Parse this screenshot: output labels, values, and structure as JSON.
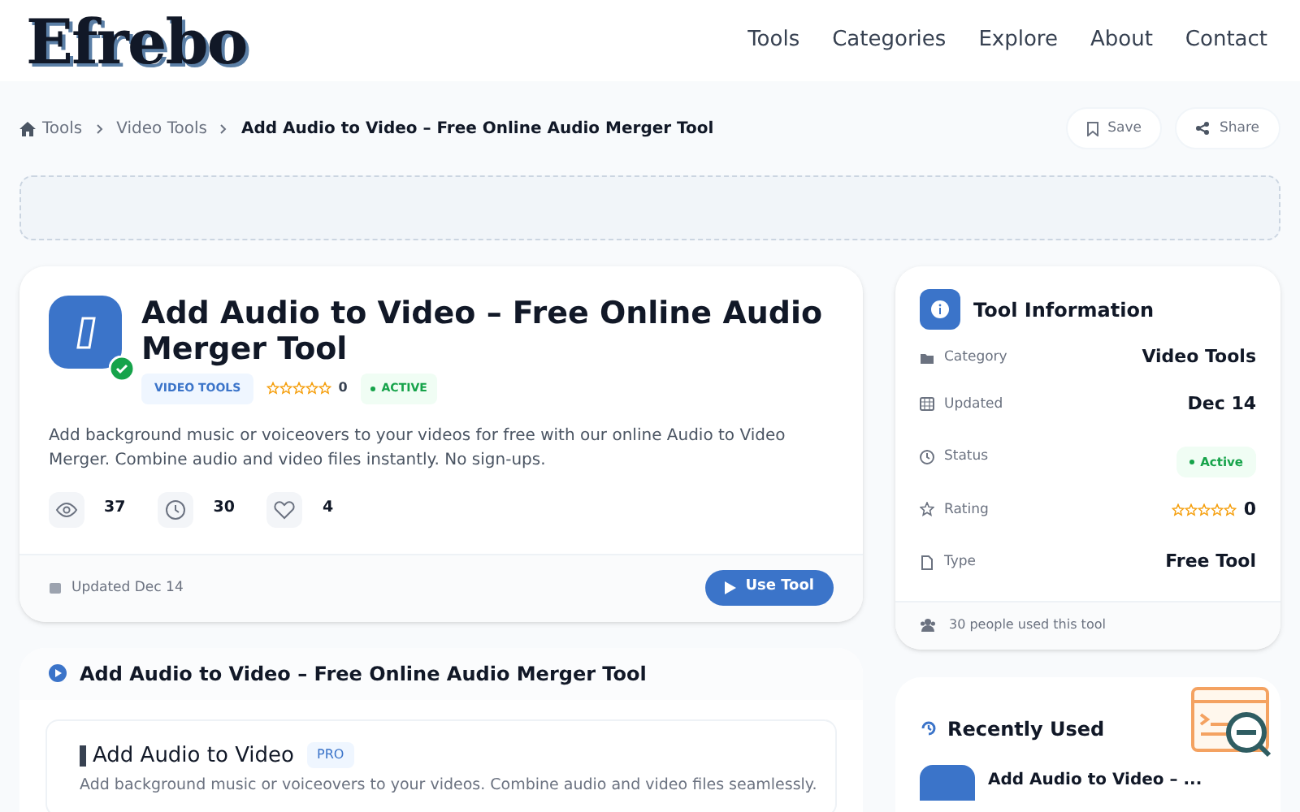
{
  "header": {
    "logo": "Efrebo",
    "nav": [
      "Tools",
      "Categories",
      "Explore",
      "About",
      "Contact"
    ]
  },
  "breadcrumb": {
    "items": [
      "Tools",
      "Video Tools"
    ],
    "current": "Add Audio to Video – Free Online Audio Merger Tool"
  },
  "actions": [
    "Save",
    "Share"
  ],
  "tool": {
    "title": "Add Audio to Video – Free Online Audio Merger Tool",
    "category": "VIDEO TOOLS",
    "stars": 0,
    "rating": "0",
    "status": "ACTIVE",
    "description": "Add background music or voiceovers to your videos for free with our online Audio to Video Merger. Combine audio and video files instantly. No sign-ups.",
    "stats": [
      {
        "kind": "views",
        "value": "37"
      },
      {
        "kind": "time",
        "value": "30"
      },
      {
        "kind": "likes",
        "value": "4"
      }
    ],
    "updated": "Updated Dec 14",
    "button": "Use Tool"
  },
  "info": {
    "title": "Tool Information",
    "rows": [
      {
        "kind": "category",
        "label": "Category",
        "value": "Video Tools"
      },
      {
        "kind": "updated",
        "label": "Updated",
        "value": "Dec 14"
      },
      {
        "kind": "status",
        "label": "Status",
        "value": "Active"
      },
      {
        "kind": "rating",
        "label": "Rating",
        "value": "0",
        "stars": 0
      },
      {
        "kind": "type",
        "label": "Type",
        "value": "Free Tool"
      }
    ],
    "footer": "30 people used this tool"
  },
  "section": {
    "title": "Add Audio to Video – Free Online Audio Merger Tool",
    "app_title": "Add Audio to Video",
    "badge": "PRO",
    "app_text": "Add background music or voiceovers to your videos. Combine audio and video files seamlessly."
  },
  "recent": {
    "title": "Recently Used",
    "items": [
      "Add Audio to Video – ..."
    ]
  }
}
